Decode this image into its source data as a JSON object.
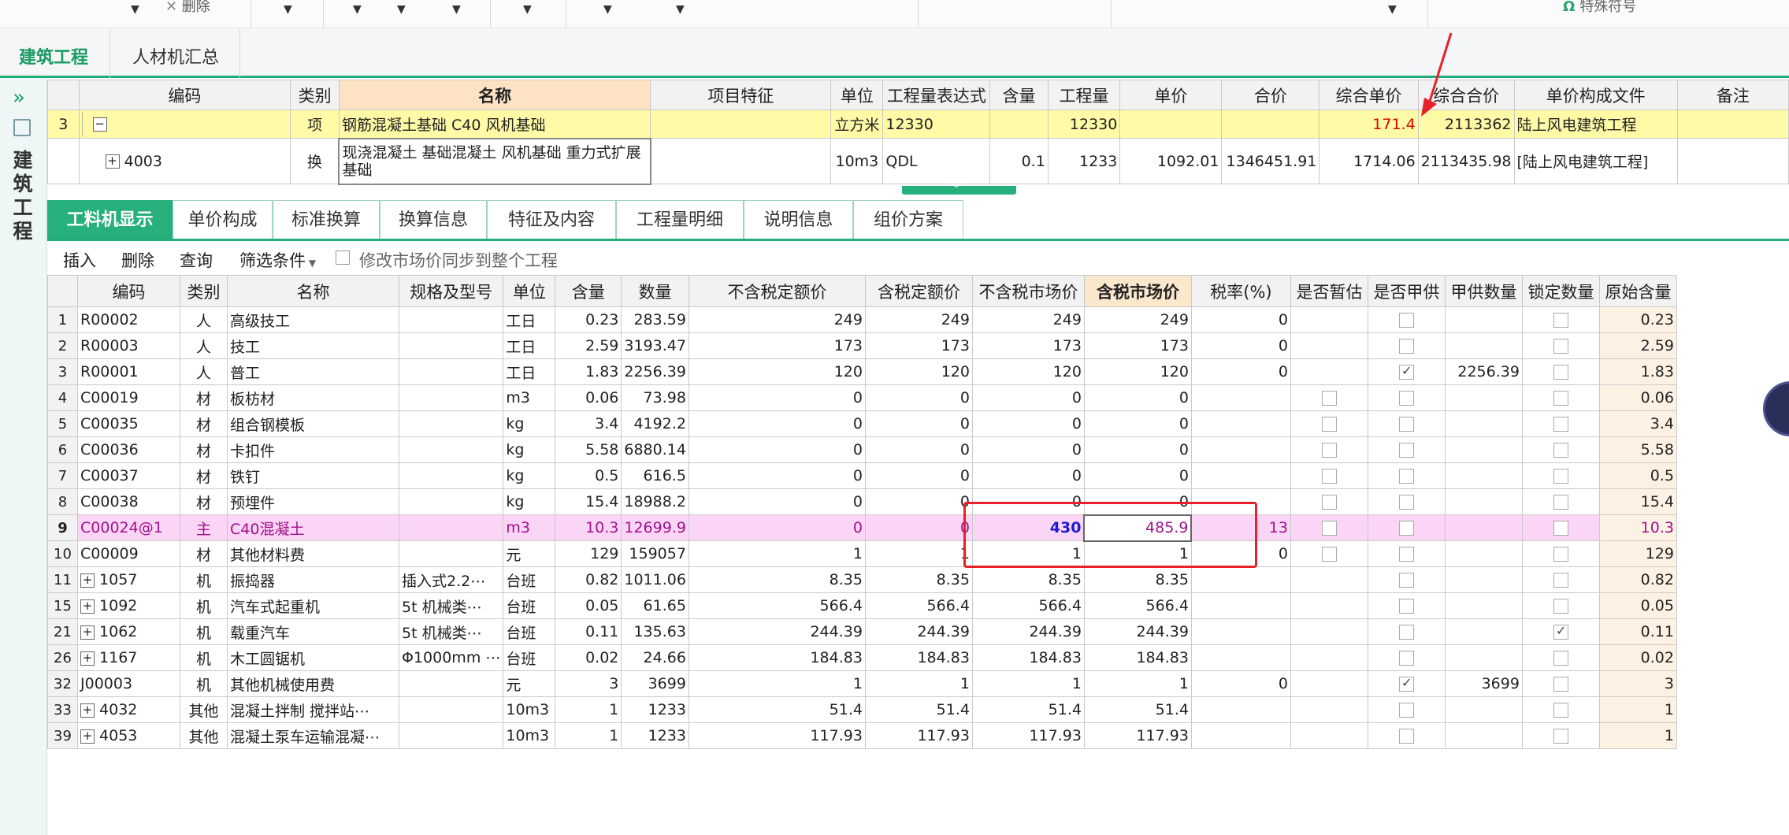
{
  "toolbar": {
    "delete_label": "删除",
    "special_symbol_label": "特殊符号",
    "special_symbol_icon": "Ω"
  },
  "doc_tabs": [
    "建筑工程",
    "人材机汇总"
  ],
  "rail": {
    "label": "建筑工程",
    "expand_icon": "»"
  },
  "upper": {
    "headers": [
      "编码",
      "类别",
      "名称",
      "项目特征",
      "单位",
      "工程量表达式",
      "含量",
      "工程量",
      "单价",
      "合价",
      "综合单价",
      "综合合价",
      "单价构成文件",
      "备注"
    ],
    "rows": [
      {
        "no": "3",
        "code": "",
        "type": "项",
        "name": "钢筋混凝土基础 C40 风机基础",
        "feature": "",
        "unit": "立方米",
        "expr": "12330",
        "content": "",
        "qty": "12330",
        "price": "",
        "total": "",
        "comp_price": "171.4",
        "comp_total": "2113362",
        "file": "陆上风电建筑工程",
        "note": ""
      },
      {
        "no": "",
        "code": "4003",
        "type": "换",
        "name": "现浇混凝土 基础混凝土 风机基础 重力式扩展基础",
        "feature": "",
        "unit": "10m3",
        "expr": "QDL",
        "content": "0.1",
        "qty": "1233",
        "price": "1092.01",
        "total": "1346451.91",
        "comp_price": "1714.06",
        "comp_total": "2113435.98",
        "file": "[陆上风电建筑工程]",
        "note": ""
      }
    ]
  },
  "sub_tabs": [
    "工料机显示",
    "单价构成",
    "标准换算",
    "换算信息",
    "特征及内容",
    "工程量明细",
    "说明信息",
    "组价方案"
  ],
  "minibar": {
    "insert": "插入",
    "delete": "删除",
    "query": "查询",
    "filter": "筛选条件",
    "sync_label": "修改市场价同步到整个工程"
  },
  "lower": {
    "headers": [
      "编码",
      "类别",
      "名称",
      "规格及型号",
      "单位",
      "含量",
      "数量",
      "不含税定额价",
      "含税定额价",
      "不含税市场价",
      "含税市场价",
      "税率(%)",
      "是否暂估",
      "是否甲供",
      "甲供数量",
      "锁定数量",
      "原始含量"
    ],
    "rows": [
      {
        "rn": "1",
        "code": "R00002",
        "tree": false,
        "type": "人",
        "name": "高级技工",
        "spec": "",
        "unit": "工日",
        "content": "0.23",
        "qty": "283.59",
        "q_ex": "249",
        "q_in": "249",
        "m_ex": "249",
        "m_in": "249",
        "tax": "0",
        "est": null,
        "supply": false,
        "supply_qty": "",
        "lock": false,
        "orig": "0.23"
      },
      {
        "rn": "2",
        "code": "R00003",
        "tree": false,
        "type": "人",
        "name": "技工",
        "spec": "",
        "unit": "工日",
        "content": "2.59",
        "qty": "3193.47",
        "q_ex": "173",
        "q_in": "173",
        "m_ex": "173",
        "m_in": "173",
        "tax": "0",
        "est": null,
        "supply": false,
        "supply_qty": "",
        "lock": false,
        "orig": "2.59"
      },
      {
        "rn": "3",
        "code": "R00001",
        "tree": false,
        "type": "人",
        "name": "普工",
        "spec": "",
        "unit": "工日",
        "content": "1.83",
        "qty": "2256.39",
        "q_ex": "120",
        "q_in": "120",
        "m_ex": "120",
        "m_in": "120",
        "tax": "0",
        "est": null,
        "supply": true,
        "supply_qty": "2256.39",
        "lock": false,
        "orig": "1.83"
      },
      {
        "rn": "4",
        "code": "C00019",
        "tree": false,
        "type": "材",
        "name": "板枋材",
        "spec": "",
        "unit": "m3",
        "content": "0.06",
        "qty": "73.98",
        "q_ex": "0",
        "q_in": "0",
        "m_ex": "0",
        "m_in": "0",
        "tax": "",
        "est": false,
        "supply": false,
        "supply_qty": "",
        "lock": false,
        "orig": "0.06"
      },
      {
        "rn": "5",
        "code": "C00035",
        "tree": false,
        "type": "材",
        "name": "组合钢模板",
        "spec": "",
        "unit": "kg",
        "content": "3.4",
        "qty": "4192.2",
        "q_ex": "0",
        "q_in": "0",
        "m_ex": "0",
        "m_in": "0",
        "tax": "",
        "est": false,
        "supply": false,
        "supply_qty": "",
        "lock": false,
        "orig": "3.4"
      },
      {
        "rn": "6",
        "code": "C00036",
        "tree": false,
        "type": "材",
        "name": "卡扣件",
        "spec": "",
        "unit": "kg",
        "content": "5.58",
        "qty": "6880.14",
        "q_ex": "0",
        "q_in": "0",
        "m_ex": "0",
        "m_in": "0",
        "tax": "",
        "est": false,
        "supply": false,
        "supply_qty": "",
        "lock": false,
        "orig": "5.58"
      },
      {
        "rn": "7",
        "code": "C00037",
        "tree": false,
        "type": "材",
        "name": "铁钉",
        "spec": "",
        "unit": "kg",
        "content": "0.5",
        "qty": "616.5",
        "q_ex": "0",
        "q_in": "0",
        "m_ex": "0",
        "m_in": "0",
        "tax": "",
        "est": false,
        "supply": false,
        "supply_qty": "",
        "lock": false,
        "orig": "0.5"
      },
      {
        "rn": "8",
        "code": "C00038",
        "tree": false,
        "type": "材",
        "name": "预埋件",
        "spec": "",
        "unit": "kg",
        "content": "15.4",
        "qty": "18988.2",
        "q_ex": "0",
        "q_in": "0",
        "m_ex": "0",
        "m_in": "0",
        "tax": "",
        "est": false,
        "supply": false,
        "supply_qty": "",
        "lock": false,
        "orig": "15.4"
      },
      {
        "rn": "9",
        "code": "C00024@1",
        "tree": false,
        "type": "主",
        "name": "C40混凝土",
        "spec": "",
        "unit": "m3",
        "content": "10.3",
        "qty": "12699.9",
        "q_ex": "0",
        "q_in": "0",
        "m_ex": "430",
        "m_in": "485.9",
        "tax": "13",
        "est": false,
        "supply": false,
        "supply_qty": "",
        "lock": false,
        "orig": "10.3",
        "main": true
      },
      {
        "rn": "10",
        "code": "C00009",
        "tree": false,
        "type": "材",
        "name": "其他材料费",
        "spec": "",
        "unit": "元",
        "content": "129",
        "qty": "159057",
        "q_ex": "1",
        "q_in": "1",
        "m_ex": "1",
        "m_in": "1",
        "tax": "0",
        "est": false,
        "supply": false,
        "supply_qty": "",
        "lock": false,
        "orig": "129"
      },
      {
        "rn": "11",
        "code": "1057",
        "tree": true,
        "type": "机",
        "name": "振捣器",
        "spec": "插入式2.2⋯",
        "unit": "台班",
        "content": "0.82",
        "qty": "1011.06",
        "q_ex": "8.35",
        "q_in": "8.35",
        "m_ex": "8.35",
        "m_in": "8.35",
        "tax": "",
        "est": null,
        "supply": false,
        "supply_qty": "",
        "lock": false,
        "orig": "0.82"
      },
      {
        "rn": "15",
        "code": "1092",
        "tree": true,
        "type": "机",
        "name": "汽车式起重机",
        "spec": "5t 机械类⋯",
        "unit": "台班",
        "content": "0.05",
        "qty": "61.65",
        "q_ex": "566.4",
        "q_in": "566.4",
        "m_ex": "566.4",
        "m_in": "566.4",
        "tax": "",
        "est": null,
        "supply": false,
        "supply_qty": "",
        "lock": false,
        "orig": "0.05"
      },
      {
        "rn": "21",
        "code": "1062",
        "tree": true,
        "type": "机",
        "name": "载重汽车",
        "spec": "5t 机械类⋯",
        "unit": "台班",
        "content": "0.11",
        "qty": "135.63",
        "q_ex": "244.39",
        "q_in": "244.39",
        "m_ex": "244.39",
        "m_in": "244.39",
        "tax": "",
        "est": null,
        "supply": false,
        "supply_qty": "",
        "lock": true,
        "orig": "0.11"
      },
      {
        "rn": "26",
        "code": "1167",
        "tree": true,
        "type": "机",
        "name": "木工圆锯机",
        "spec": "Φ1000mm ⋯",
        "unit": "台班",
        "content": "0.02",
        "qty": "24.66",
        "q_ex": "184.83",
        "q_in": "184.83",
        "m_ex": "184.83",
        "m_in": "184.83",
        "tax": "",
        "est": null,
        "supply": false,
        "supply_qty": "",
        "lock": false,
        "orig": "0.02"
      },
      {
        "rn": "32",
        "code": "J00003",
        "tree": false,
        "type": "机",
        "name": "其他机械使用费",
        "spec": "",
        "unit": "元",
        "content": "3",
        "qty": "3699",
        "q_ex": "1",
        "q_in": "1",
        "m_ex": "1",
        "m_in": "1",
        "tax": "0",
        "est": null,
        "supply": true,
        "supply_qty": "3699",
        "lock": false,
        "orig": "3"
      },
      {
        "rn": "33",
        "code": "4032",
        "tree": true,
        "type": "其他",
        "name": "混凝土拌制 搅拌站⋯",
        "spec": "",
        "unit": "10m3",
        "content": "1",
        "qty": "1233",
        "q_ex": "51.4",
        "q_in": "51.4",
        "m_ex": "51.4",
        "m_in": "51.4",
        "tax": "",
        "est": null,
        "supply": false,
        "supply_qty": "",
        "lock": false,
        "orig": "1"
      },
      {
        "rn": "39",
        "code": "4053",
        "tree": true,
        "type": "其他",
        "name": "混凝土泵车运输混凝⋯",
        "spec": "",
        "unit": "10m3",
        "content": "1",
        "qty": "1233",
        "q_ex": "117.93",
        "q_in": "117.93",
        "m_ex": "117.93",
        "m_in": "117.93",
        "tax": "",
        "est": null,
        "supply": false,
        "supply_qty": "",
        "lock": false,
        "orig": "1"
      }
    ]
  },
  "colors": {
    "accent": "#27b07c",
    "annotation_red": "#e8202a",
    "main_row_bg": "#fbd5f5",
    "selected_row_bg": "#fffaa6"
  }
}
